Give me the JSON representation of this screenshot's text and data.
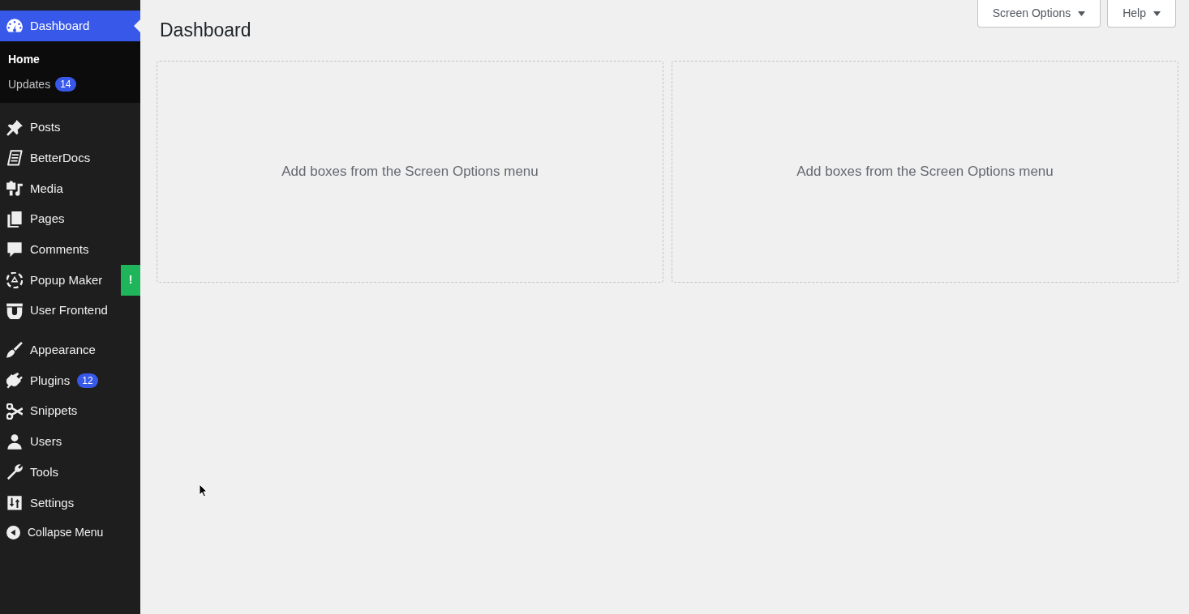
{
  "sidebar": {
    "groups": [
      {
        "items": [
          {
            "label": "Dashboard",
            "selected": true,
            "children": [
              {
                "label": "Home",
                "selected": true
              },
              {
                "label": "Updates",
                "selected": false,
                "badge": {
                  "kind": "count",
                  "text": "14"
                }
              }
            ]
          }
        ]
      },
      {
        "items": [
          {
            "label": "Posts",
            "selected": false
          },
          {
            "label": "BetterDocs",
            "selected": false
          },
          {
            "label": "Media",
            "selected": false
          },
          {
            "label": "Pages",
            "selected": false
          },
          {
            "label": "Comments",
            "selected": false
          },
          {
            "label": "Popup Maker",
            "selected": false,
            "badge": {
              "kind": "alert",
              "text": "!"
            }
          },
          {
            "label": "User Frontend",
            "selected": false
          }
        ]
      },
      {
        "items": [
          {
            "label": "Appearance",
            "selected": false
          },
          {
            "label": "Plugins",
            "selected": false,
            "badge": {
              "kind": "count",
              "text": "12"
            }
          },
          {
            "label": "Snippets",
            "selected": false
          },
          {
            "label": "Users",
            "selected": false
          },
          {
            "label": "Tools",
            "selected": false
          },
          {
            "label": "Settings",
            "selected": false
          }
        ]
      }
    ],
    "collapse_button": {
      "label": "Collapse Menu"
    }
  },
  "header_buttons": [
    {
      "label": "Screen Options"
    },
    {
      "label": "Help"
    }
  ],
  "page_title": "Dashboard",
  "dashboard_boxes": [
    {
      "message": "Add boxes from the Screen Options menu"
    },
    {
      "message": "Add boxes from the Screen Options menu"
    }
  ]
}
